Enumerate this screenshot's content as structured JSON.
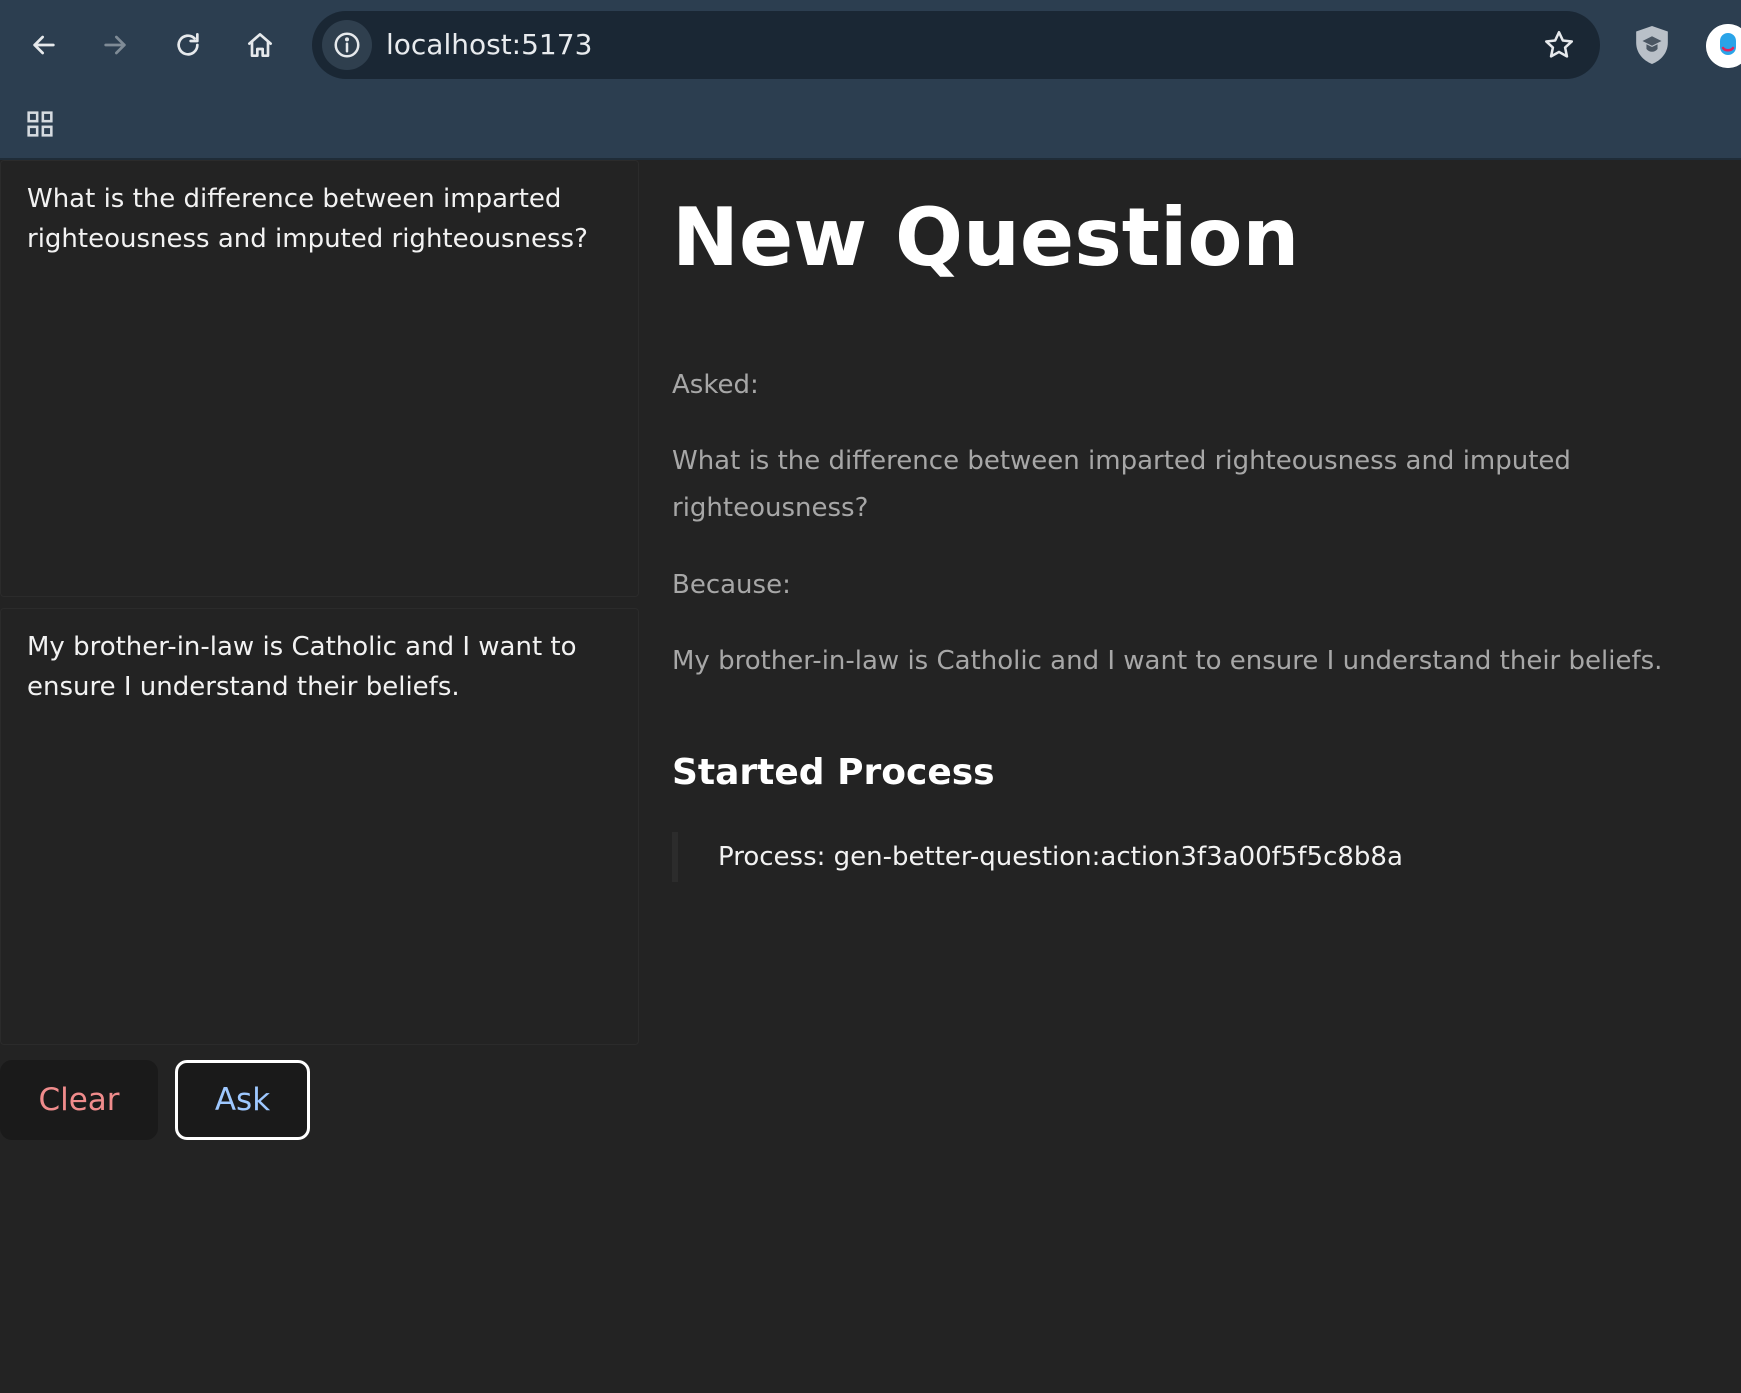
{
  "browser": {
    "url": "localhost:5173",
    "icons": {
      "back": "arrow-left-icon",
      "forward": "arrow-right-icon",
      "reload": "reload-icon",
      "home": "home-icon",
      "site_info": "info-icon",
      "bookmark": "star-icon",
      "extension": "shield-icon",
      "profile": "avatar-icon",
      "apps": "apps-grid-icon"
    }
  },
  "form": {
    "question_value": "What is the difference between imparted righteousness and imputed righteousness?",
    "reason_value": "My brother-in-law is Catholic and I want to ensure I understand their beliefs.",
    "clear_label": "Clear",
    "ask_label": "Ask"
  },
  "main": {
    "title": "New Question",
    "asked_label": "Asked:",
    "asked_text": "What is the difference between imparted righteousness and imputed righteousness?",
    "because_label": "Because:",
    "because_text": "My brother-in-law is Catholic and I want to ensure I understand their beliefs.",
    "section_title": "Started Process",
    "process_text": "Process: gen-better-question:action3f3a00f5f5c8b8a"
  },
  "colors": {
    "page_background": "#232323",
    "chrome_background": "#2c3e50",
    "clear_text": "#f08c8c",
    "ask_text": "#9ec8ff"
  }
}
